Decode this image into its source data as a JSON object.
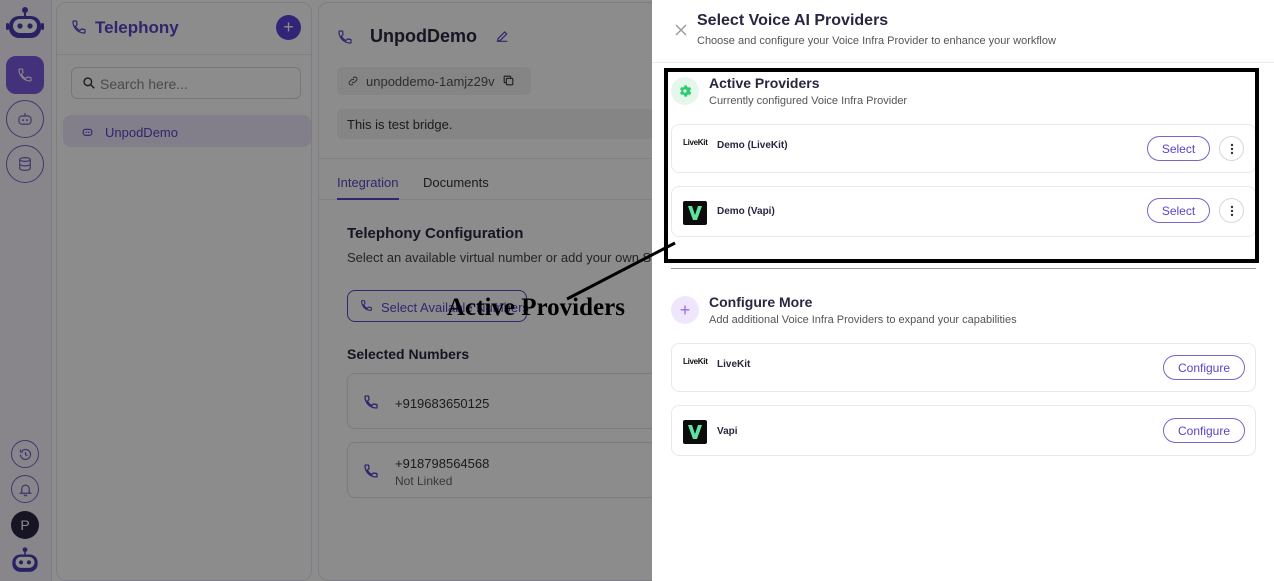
{
  "sidebar": {
    "title": "Telephony",
    "search_placeholder": "Search here...",
    "items": [
      {
        "label": "UnpodDemo"
      }
    ],
    "avatar_initial": "P"
  },
  "bridge": {
    "title": "UnpodDemo",
    "slug": "unpoddemo-1amjz29v",
    "description": "This is test bridge.",
    "tabs": [
      {
        "label": "Integration"
      },
      {
        "label": "Documents"
      }
    ],
    "telephony_title": "Telephony Configuration",
    "telephony_sub": "Select an available virtual number or add your own SIP",
    "select_numbers_label": "Select Available Numbers",
    "selected_numbers_title": "Selected Numbers",
    "numbers": [
      {
        "number": "+919683650125",
        "status": ""
      },
      {
        "number": "+918798564568",
        "status": "Not Linked"
      }
    ]
  },
  "drawer": {
    "title": "Select Voice AI Providers",
    "subtitle": "Choose and configure your Voice Infra Provider to enhance your workflow",
    "active": {
      "title": "Active Providers",
      "subtitle": "Currently configured Voice Infra Provider",
      "providers": [
        {
          "name": "Demo (LiveKit)",
          "logo": "LiveKit",
          "action": "Select"
        },
        {
          "name": "Demo (Vapi)",
          "logo": "V",
          "action": "Select"
        }
      ]
    },
    "more": {
      "title": "Configure More",
      "subtitle": "Add additional Voice Infra Providers to expand your capabilities",
      "providers": [
        {
          "name": "LiveKit",
          "logo": "LiveKit",
          "action": "Configure"
        },
        {
          "name": "Vapi",
          "logo": "V",
          "action": "Configure"
        }
      ]
    }
  },
  "annotation": {
    "label": "Active Providers"
  },
  "colors": {
    "accent": "#5b44c9",
    "overlay": "rgba(0,0,0,0.45)",
    "active_icon": "#2ecc71"
  }
}
